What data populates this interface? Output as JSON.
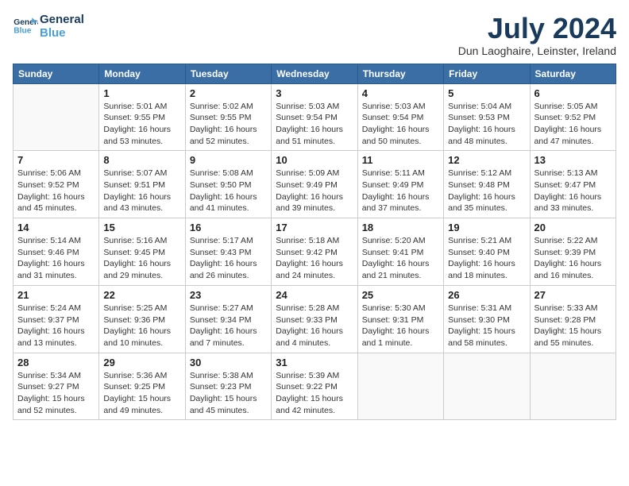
{
  "logo": {
    "line1": "General",
    "line2": "Blue"
  },
  "title": "July 2024",
  "location": "Dun Laoghaire, Leinster, Ireland",
  "days_of_week": [
    "Sunday",
    "Monday",
    "Tuesday",
    "Wednesday",
    "Thursday",
    "Friday",
    "Saturday"
  ],
  "weeks": [
    [
      {
        "day": "",
        "info": ""
      },
      {
        "day": "1",
        "info": "Sunrise: 5:01 AM\nSunset: 9:55 PM\nDaylight: 16 hours\nand 53 minutes."
      },
      {
        "day": "2",
        "info": "Sunrise: 5:02 AM\nSunset: 9:55 PM\nDaylight: 16 hours\nand 52 minutes."
      },
      {
        "day": "3",
        "info": "Sunrise: 5:03 AM\nSunset: 9:54 PM\nDaylight: 16 hours\nand 51 minutes."
      },
      {
        "day": "4",
        "info": "Sunrise: 5:03 AM\nSunset: 9:54 PM\nDaylight: 16 hours\nand 50 minutes."
      },
      {
        "day": "5",
        "info": "Sunrise: 5:04 AM\nSunset: 9:53 PM\nDaylight: 16 hours\nand 48 minutes."
      },
      {
        "day": "6",
        "info": "Sunrise: 5:05 AM\nSunset: 9:52 PM\nDaylight: 16 hours\nand 47 minutes."
      }
    ],
    [
      {
        "day": "7",
        "info": "Sunrise: 5:06 AM\nSunset: 9:52 PM\nDaylight: 16 hours\nand 45 minutes."
      },
      {
        "day": "8",
        "info": "Sunrise: 5:07 AM\nSunset: 9:51 PM\nDaylight: 16 hours\nand 43 minutes."
      },
      {
        "day": "9",
        "info": "Sunrise: 5:08 AM\nSunset: 9:50 PM\nDaylight: 16 hours\nand 41 minutes."
      },
      {
        "day": "10",
        "info": "Sunrise: 5:09 AM\nSunset: 9:49 PM\nDaylight: 16 hours\nand 39 minutes."
      },
      {
        "day": "11",
        "info": "Sunrise: 5:11 AM\nSunset: 9:49 PM\nDaylight: 16 hours\nand 37 minutes."
      },
      {
        "day": "12",
        "info": "Sunrise: 5:12 AM\nSunset: 9:48 PM\nDaylight: 16 hours\nand 35 minutes."
      },
      {
        "day": "13",
        "info": "Sunrise: 5:13 AM\nSunset: 9:47 PM\nDaylight: 16 hours\nand 33 minutes."
      }
    ],
    [
      {
        "day": "14",
        "info": "Sunrise: 5:14 AM\nSunset: 9:46 PM\nDaylight: 16 hours\nand 31 minutes."
      },
      {
        "day": "15",
        "info": "Sunrise: 5:16 AM\nSunset: 9:45 PM\nDaylight: 16 hours\nand 29 minutes."
      },
      {
        "day": "16",
        "info": "Sunrise: 5:17 AM\nSunset: 9:43 PM\nDaylight: 16 hours\nand 26 minutes."
      },
      {
        "day": "17",
        "info": "Sunrise: 5:18 AM\nSunset: 9:42 PM\nDaylight: 16 hours\nand 24 minutes."
      },
      {
        "day": "18",
        "info": "Sunrise: 5:20 AM\nSunset: 9:41 PM\nDaylight: 16 hours\nand 21 minutes."
      },
      {
        "day": "19",
        "info": "Sunrise: 5:21 AM\nSunset: 9:40 PM\nDaylight: 16 hours\nand 18 minutes."
      },
      {
        "day": "20",
        "info": "Sunrise: 5:22 AM\nSunset: 9:39 PM\nDaylight: 16 hours\nand 16 minutes."
      }
    ],
    [
      {
        "day": "21",
        "info": "Sunrise: 5:24 AM\nSunset: 9:37 PM\nDaylight: 16 hours\nand 13 minutes."
      },
      {
        "day": "22",
        "info": "Sunrise: 5:25 AM\nSunset: 9:36 PM\nDaylight: 16 hours\nand 10 minutes."
      },
      {
        "day": "23",
        "info": "Sunrise: 5:27 AM\nSunset: 9:34 PM\nDaylight: 16 hours\nand 7 minutes."
      },
      {
        "day": "24",
        "info": "Sunrise: 5:28 AM\nSunset: 9:33 PM\nDaylight: 16 hours\nand 4 minutes."
      },
      {
        "day": "25",
        "info": "Sunrise: 5:30 AM\nSunset: 9:31 PM\nDaylight: 16 hours\nand 1 minute."
      },
      {
        "day": "26",
        "info": "Sunrise: 5:31 AM\nSunset: 9:30 PM\nDaylight: 15 hours\nand 58 minutes."
      },
      {
        "day": "27",
        "info": "Sunrise: 5:33 AM\nSunset: 9:28 PM\nDaylight: 15 hours\nand 55 minutes."
      }
    ],
    [
      {
        "day": "28",
        "info": "Sunrise: 5:34 AM\nSunset: 9:27 PM\nDaylight: 15 hours\nand 52 minutes."
      },
      {
        "day": "29",
        "info": "Sunrise: 5:36 AM\nSunset: 9:25 PM\nDaylight: 15 hours\nand 49 minutes."
      },
      {
        "day": "30",
        "info": "Sunrise: 5:38 AM\nSunset: 9:23 PM\nDaylight: 15 hours\nand 45 minutes."
      },
      {
        "day": "31",
        "info": "Sunrise: 5:39 AM\nSunset: 9:22 PM\nDaylight: 15 hours\nand 42 minutes."
      },
      {
        "day": "",
        "info": ""
      },
      {
        "day": "",
        "info": ""
      },
      {
        "day": "",
        "info": ""
      }
    ]
  ]
}
